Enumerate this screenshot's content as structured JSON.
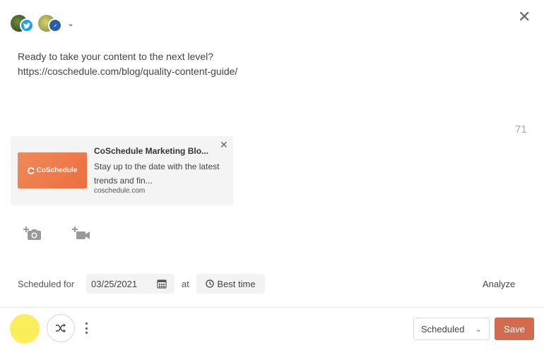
{
  "header": {
    "accounts": [
      {
        "name": "account-avatar",
        "network": "twitter",
        "icon": "twitter-icon"
      },
      {
        "name": "account-avatar",
        "network": "pinterest",
        "icon": "pinterest-icon"
      }
    ],
    "dropdown_icon": "chevron-down-icon",
    "close_icon": "close-icon"
  },
  "message": {
    "line1": "Ready to take your content to the next level?",
    "line2": "https://coschedule.com/blog/quality-content-guide/",
    "char_count": "71"
  },
  "link_preview": {
    "title": "CoSchedule Marketing Blo...",
    "description": "Stay up to the date with the latest trends and fin...",
    "domain": "coschedule.com",
    "thumbnail_text": "CoSchedule"
  },
  "media": {
    "photo_icon": "add-photo-icon",
    "video_icon": "add-video-icon"
  },
  "schedule": {
    "label": "Scheduled for",
    "date": "03/25/2021",
    "at_label": "at",
    "best_time_label": "Best time",
    "analyze_label": "Analyze"
  },
  "footer": {
    "status_value": "Scheduled",
    "save_label": "Save"
  },
  "colors": {
    "accent": "#d16c50",
    "yellow": "#faef5b",
    "twitter": "#1da1f2"
  }
}
